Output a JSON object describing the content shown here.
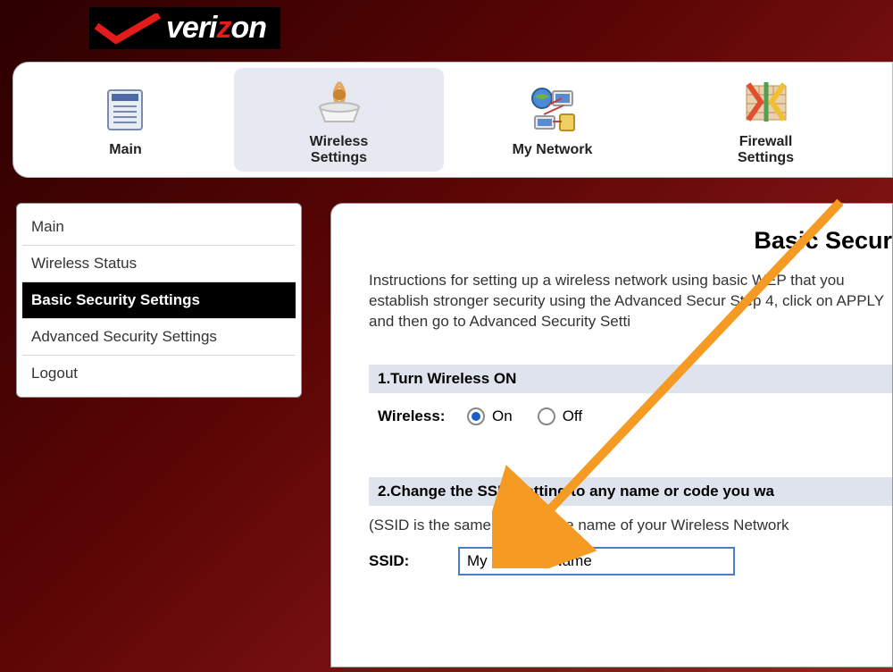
{
  "brand": "verizon",
  "topnav": [
    {
      "label": "Main"
    },
    {
      "label": "Wireless\nSettings"
    },
    {
      "label": "My Network"
    },
    {
      "label": "Firewall\nSettings"
    }
  ],
  "sidebar": [
    {
      "label": "Main"
    },
    {
      "label": "Wireless Status"
    },
    {
      "label": "Basic Security Settings"
    },
    {
      "label": "Advanced Security Settings"
    },
    {
      "label": "Logout"
    }
  ],
  "page": {
    "title": "Basic Secur",
    "instructions": "Instructions for setting up a wireless network using basic WEP that you establish stronger security using the Advanced Secur Step 4, click on APPLY and then go to Advanced Security Setti",
    "section1_head": "1.Turn Wireless ON",
    "wireless_label": "Wireless:",
    "on_label": "On",
    "off_label": "Off",
    "section2_head": "2.Change the SSID setting to any name or code you wa",
    "ssid_help": "(SSID is the same thing as the name of your Wireless Network",
    "ssid_label": "SSID:",
    "ssid_value": "My Network Name"
  }
}
